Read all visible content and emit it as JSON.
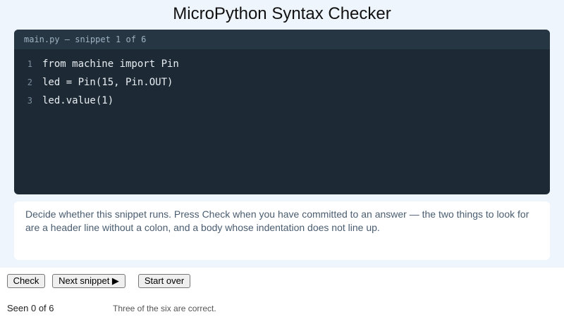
{
  "app": {
    "title": "MicroPython Syntax Checker"
  },
  "editor": {
    "header": "main.py — snippet 1 of 6",
    "lines": [
      {
        "num": "1",
        "code": "from machine import Pin"
      },
      {
        "num": "2",
        "code": "led = Pin(15, Pin.OUT)"
      },
      {
        "num": "3",
        "code": "led.value(1)"
      }
    ]
  },
  "instructions": {
    "text": "Decide whether this snippet runs. Press Check when you have committed to an answer — the two things to look for are a header line without a colon, and a body whose indentation does not line up."
  },
  "controls": {
    "check_label": "Check",
    "next_label": "Next snippet ▶",
    "start_over_label": "Start over"
  },
  "status": {
    "seen": "Seen 0 of 6",
    "hint": "Three of the six are correct."
  },
  "colors": {
    "page_background": "#eef5fd",
    "editor_background": "#1d2a35",
    "editor_header_background": "#263642",
    "code_text": "#e9eef2",
    "line_number": "#7b8d9c",
    "instruction_text": "#4a5d70"
  }
}
